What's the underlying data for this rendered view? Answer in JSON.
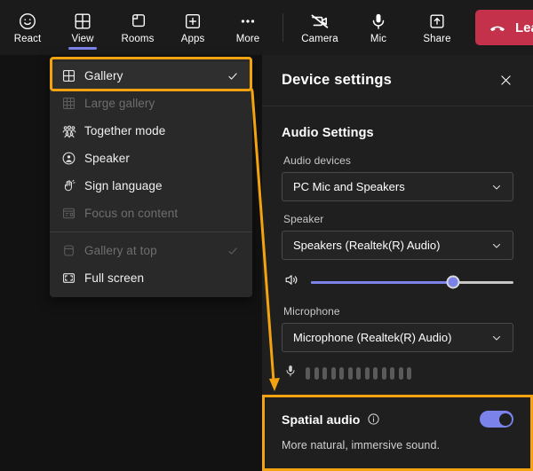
{
  "toolbar": {
    "items": [
      {
        "label": "React",
        "icon": "smiley-icon",
        "active": false
      },
      {
        "label": "View",
        "icon": "grid-2x2-icon",
        "active": true
      },
      {
        "label": "Rooms",
        "icon": "breakout-rooms-icon",
        "active": false
      },
      {
        "label": "Apps",
        "icon": "plus-square-icon",
        "active": false
      },
      {
        "label": "More",
        "icon": "ellipsis-icon",
        "active": false
      }
    ],
    "call_items": [
      {
        "label": "Camera",
        "icon": "camera-off-icon"
      },
      {
        "label": "Mic",
        "icon": "microphone-icon"
      },
      {
        "label": "Share",
        "icon": "share-up-arrow-icon"
      }
    ],
    "leave_label": "Leave",
    "leave_color": "#c4314b"
  },
  "view_menu": {
    "items": [
      {
        "label": "Gallery",
        "icon": "grid-2x2-icon",
        "checked": true,
        "disabled": false,
        "highlighted": true
      },
      {
        "label": "Large gallery",
        "icon": "grid-3x3-icon",
        "checked": false,
        "disabled": true,
        "highlighted": false
      },
      {
        "label": "Together mode",
        "icon": "people-group-icon",
        "checked": false,
        "disabled": false,
        "highlighted": false
      },
      {
        "label": "Speaker",
        "icon": "person-circle-icon",
        "checked": false,
        "disabled": false,
        "highlighted": false
      },
      {
        "label": "Sign language",
        "icon": "hand-sign-icon",
        "checked": false,
        "disabled": false,
        "highlighted": false
      },
      {
        "label": "Focus on content",
        "icon": "content-focus-icon",
        "checked": false,
        "disabled": true,
        "highlighted": false
      }
    ],
    "items_after_divider": [
      {
        "label": "Gallery at top",
        "icon": "gallery-top-icon",
        "checked": true,
        "disabled": true,
        "highlighted": false
      },
      {
        "label": "Full screen",
        "icon": "full-screen-icon",
        "checked": false,
        "disabled": false,
        "highlighted": false
      }
    ]
  },
  "device_settings": {
    "title": "Device settings",
    "close_icon": "close-icon",
    "audio_section_title": "Audio Settings",
    "audio_devices_label": "Audio devices",
    "audio_devices_value": "PC Mic and Speakers",
    "speaker_label": "Speaker",
    "speaker_value": "Speakers (Realtek(R) Audio)",
    "volume_percent": 70,
    "volume_icon": "speaker-volume-icon",
    "microphone_label": "Microphone",
    "microphone_value": "Microphone (Realtek(R) Audio)",
    "mic_meter_icon": "microphone-icon",
    "mic_meter_bars": 13,
    "spatial_audio_label": "Spatial audio",
    "spatial_audio_info_icon": "info-circle-icon",
    "spatial_audio_enabled": true,
    "spatial_audio_description": "More natural, immersive sound."
  },
  "annotation": {
    "highlight_color": "#f2a30f",
    "arrow_from": "Gallery menu item",
    "arrow_to": "Spatial audio section"
  },
  "colors": {
    "accent": "#7b83eb",
    "leave": "#c4314b",
    "highlight": "#f2a30f",
    "panel_bg": "#1f1f1f",
    "menu_bg": "#292929",
    "toolbar_bg": "#1b1b1b"
  }
}
